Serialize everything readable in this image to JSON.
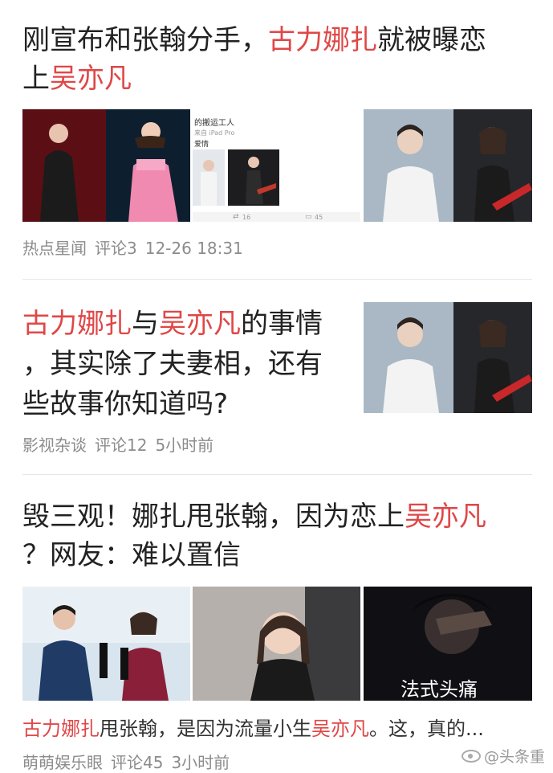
{
  "articles": [
    {
      "title_parts": [
        "刚宣布和张翰分手，",
        "古力娜扎",
        "就被曝恋",
        "上",
        "吴亦凡"
      ],
      "source": "热点星闻",
      "comments": "评论3",
      "time": "12-26 18:31",
      "image_text": {
        "account": "的搬运工人",
        "device": "来自 iPad Pro",
        "tag": "爱情",
        "reposts": "16",
        "replies": "45"
      }
    },
    {
      "title_parts": [
        "古力娜扎",
        "与",
        "吴亦凡",
        "的事情",
        "，其实除了夫妻相，还有",
        "些故事你知道吗?"
      ],
      "source": "影视杂谈",
      "comments": "评论12",
      "time": "5小时前"
    },
    {
      "title_parts": [
        "毁三观！娜扎甩张翰，因为恋上",
        "吴亦凡",
        "？网友：难以置信"
      ],
      "caption": "法式头痛",
      "summary_parts": [
        "古力娜扎",
        "甩张翰，是因为流量小生",
        "吴亦凡",
        "。这，真的..."
      ],
      "source": "萌萌娱乐眼",
      "comments": "评论45",
      "time": "3小时前"
    }
  ],
  "watermark": "@头条重",
  "colors": {
    "highlight": "#e04747",
    "meta": "#8c8c8c",
    "text": "#222222"
  }
}
